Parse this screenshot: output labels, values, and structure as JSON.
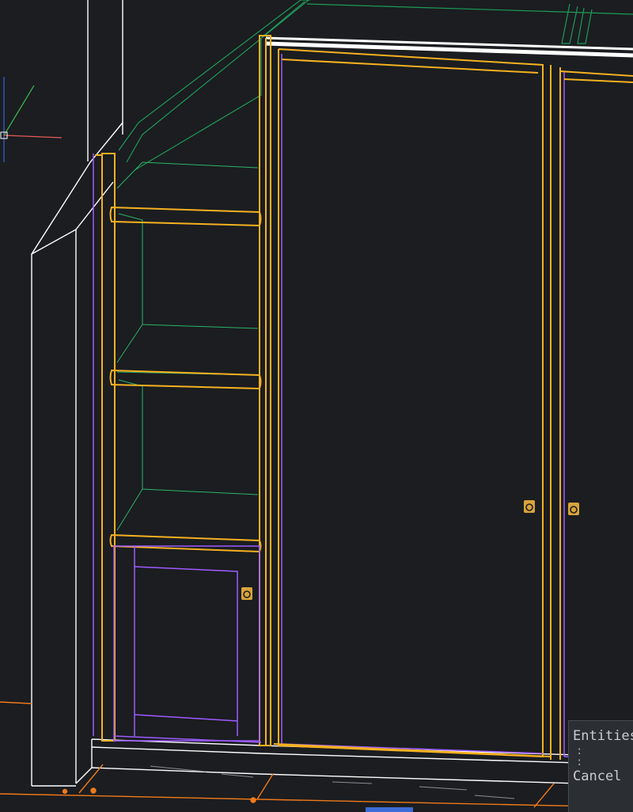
{
  "app": {
    "name": "CAD viewport",
    "view": "3D wireframe"
  },
  "colors": {
    "background": "#1b1d20",
    "cabinet_outline": "#f5b121",
    "door_inner_outline": "#9d5bff",
    "shelf_back_lines": "#2bb36a",
    "roof_lines": "#1e9a58",
    "wall_outline": "#ffffff",
    "ucs_x_axis": "#e65a5a",
    "ucs_y_axis": "#3fbf4d",
    "ucs_z_axis": "#3a63e6",
    "floor_lines": "#f07a1a",
    "grip_marker": "#d9a33b",
    "panel_bg": "#2b2e33",
    "panel_text": "#c9ccd1"
  },
  "icons": {
    "ucs": "ucs-axes-icon",
    "door_handle": "door-handle-marker-icon"
  },
  "command_panel": {
    "line1": "Entities",
    "line2": ":",
    "line3": ":",
    "line4": "Cancel"
  }
}
